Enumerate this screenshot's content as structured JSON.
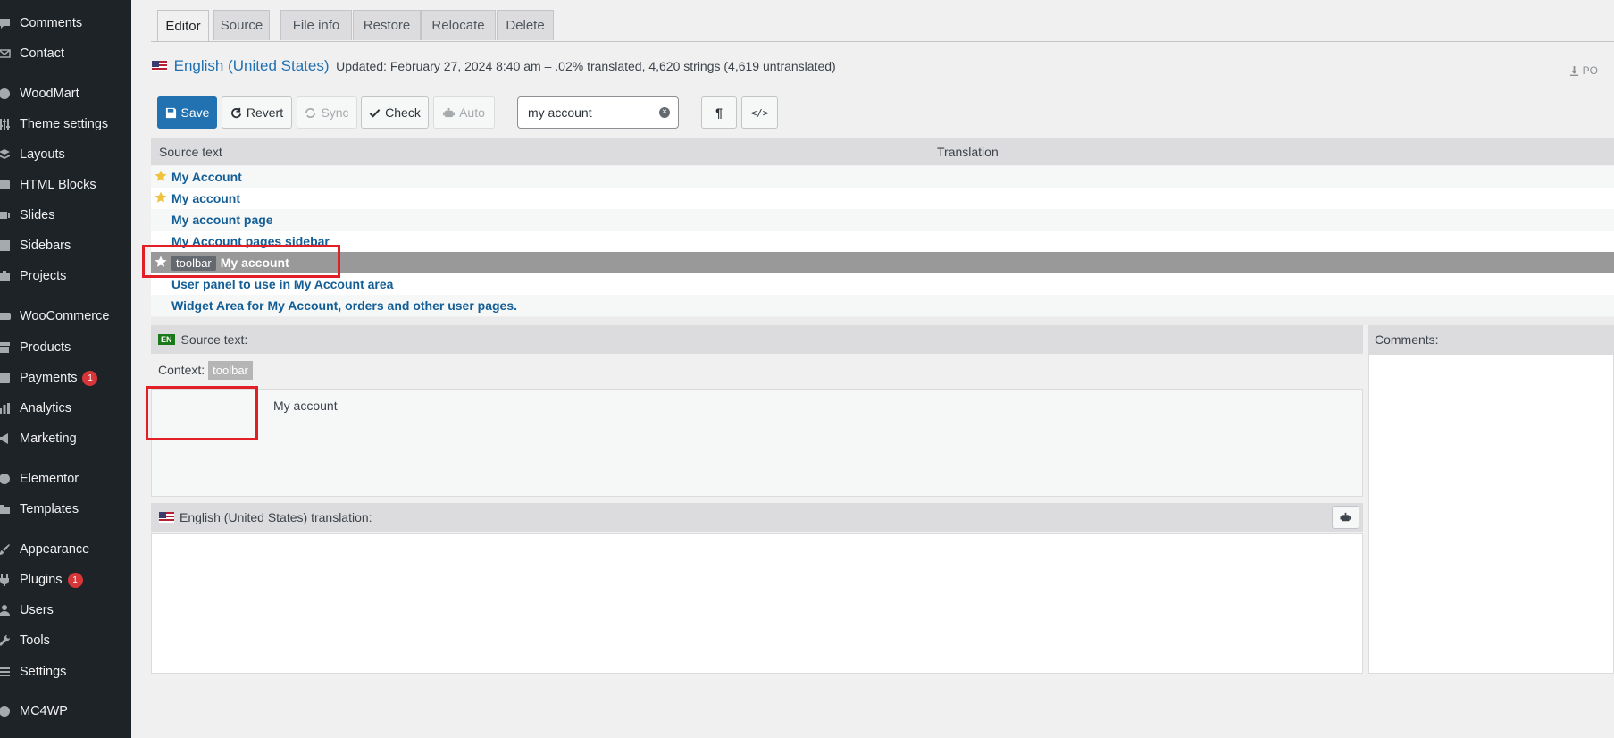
{
  "sidebar": {
    "items": [
      {
        "label": "Comments",
        "icon": "comment-icon",
        "badge": null
      },
      {
        "label": "Contact",
        "icon": "envelope-icon",
        "badge": null
      },
      {
        "label": "WoodMart",
        "icon": "woodmart-icon",
        "badge": null
      },
      {
        "label": "Theme settings",
        "icon": "sliders-icon",
        "badge": null
      },
      {
        "label": "Layouts",
        "icon": "layers-icon",
        "badge": null
      },
      {
        "label": "HTML Blocks",
        "icon": "code-icon",
        "badge": null
      },
      {
        "label": "Slides",
        "icon": "slides-icon",
        "badge": null
      },
      {
        "label": "Sidebars",
        "icon": "sidebar-icon",
        "badge": null
      },
      {
        "label": "Projects",
        "icon": "briefcase-icon",
        "badge": null
      },
      {
        "label": "WooCommerce",
        "icon": "woocommerce-icon",
        "badge": null
      },
      {
        "label": "Products",
        "icon": "archive-icon",
        "badge": null
      },
      {
        "label": "Payments",
        "icon": "dollar-icon",
        "badge": "1"
      },
      {
        "label": "Analytics",
        "icon": "bar-chart-icon",
        "badge": null
      },
      {
        "label": "Marketing",
        "icon": "megaphone-icon",
        "badge": null
      },
      {
        "label": "Elementor",
        "icon": "elementor-icon",
        "badge": null
      },
      {
        "label": "Templates",
        "icon": "folder-icon",
        "badge": null
      },
      {
        "label": "Appearance",
        "icon": "paintbrush-icon",
        "badge": null
      },
      {
        "label": "Plugins",
        "icon": "plug-icon",
        "badge": "1"
      },
      {
        "label": "Users",
        "icon": "user-icon",
        "badge": null
      },
      {
        "label": "Tools",
        "icon": "wrench-icon",
        "badge": null
      },
      {
        "label": "Settings",
        "icon": "settings-icon",
        "badge": null
      },
      {
        "label": "MC4WP",
        "icon": "mc4wp-icon",
        "badge": null
      }
    ]
  },
  "tabs": [
    {
      "label": "Editor",
      "active": true
    },
    {
      "label": "Source",
      "active": false
    },
    {
      "label": "File info",
      "active": false
    },
    {
      "label": "Restore",
      "active": false
    },
    {
      "label": "Relocate",
      "active": false
    },
    {
      "label": "Delete",
      "active": false
    }
  ],
  "header": {
    "language": "English (United States)",
    "meta": "Updated: February 27, 2024 8:40 am – .02% translated, 4,620 strings (4,619 untranslated)",
    "download_label": "PO"
  },
  "toolbar": {
    "save": "Save",
    "revert": "Revert",
    "sync": "Sync",
    "check": "Check",
    "auto": "Auto",
    "search_value": "my account"
  },
  "grid": {
    "col_source": "Source text",
    "col_translation": "Translation",
    "rows": [
      {
        "text": "My Account",
        "context": "",
        "starred": true
      },
      {
        "text": "My account",
        "context": "",
        "starred": true
      },
      {
        "text": "My account page",
        "context": "",
        "starred": false
      },
      {
        "text": "My Account pages sidebar",
        "context": "",
        "starred": false
      },
      {
        "text": "My account",
        "context": "toolbar",
        "starred": true,
        "selected": true
      },
      {
        "text": "User panel to use in My Account area",
        "context": "",
        "starred": false
      },
      {
        "text": "Widget Area for My Account, orders and other user pages.",
        "context": "",
        "starred": false
      }
    ]
  },
  "source_panel": {
    "lang_badge": "EN",
    "title": "Source text:",
    "context_label": "Context:",
    "context_value": "toolbar",
    "text": "My account"
  },
  "translation_panel": {
    "title": "English (United States) translation:"
  },
  "comments_panel": {
    "title": "Comments:"
  },
  "colors": {
    "sidebar_bg": "#1d2327",
    "primary": "#2271b1",
    "link": "#135e96",
    "highlight_box": "#e21f26",
    "badge": "#d63638"
  }
}
